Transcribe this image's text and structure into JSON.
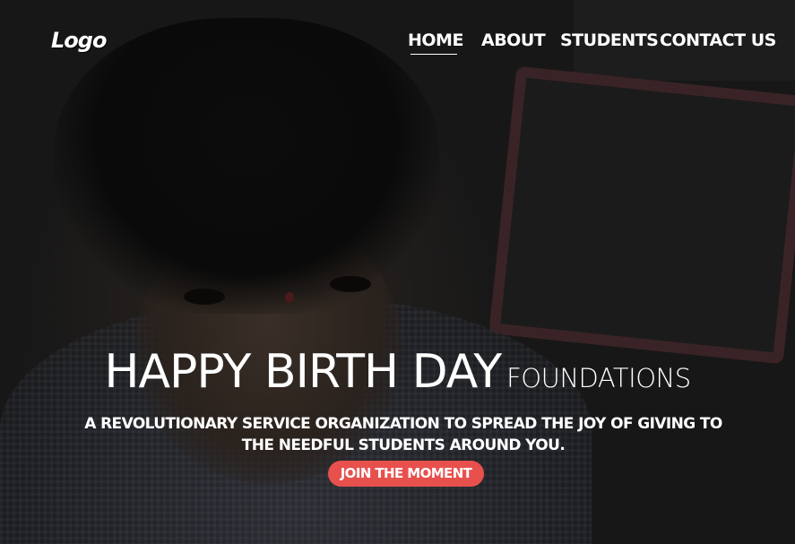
{
  "header": {
    "logo_text": "Logo",
    "nav": {
      "home": "HOME",
      "about": "ABOUT",
      "students": "STUDENTS",
      "contact": "CONTACT US"
    },
    "active_item": "HOME"
  },
  "hero": {
    "title_main": "HAPPY BIRTH DAY",
    "title_sub": "FOUNDATIONS",
    "tagline": "A REVOLUTIONARY SERVICE ORGANIZATION TO SPREAD THE JOY OF GIVING TO THE NEEDFUL STUDENTS AROUND YOU.",
    "cta_label": "JOIN THE MOMENT",
    "background_image": "darkened photo of a child looking up"
  },
  "colors": {
    "accent": "#e8504d",
    "text": "#ffffff",
    "overlay": "#141414"
  }
}
